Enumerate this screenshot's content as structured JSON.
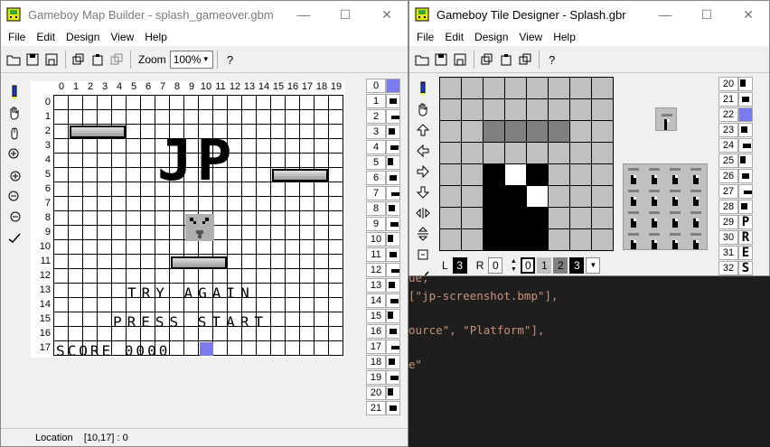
{
  "map_window": {
    "title": "Gameboy Map Builder - splash_gameover.gbm",
    "menu": [
      "File",
      "Edit",
      "Design",
      "View",
      "Help"
    ],
    "zoom_label": "Zoom",
    "zoom_value": "100%",
    "column_headers": [
      "0",
      "1",
      "2",
      "3",
      "4",
      "5",
      "6",
      "7",
      "8",
      "9",
      "10",
      "11",
      "12",
      "13",
      "14",
      "15",
      "16",
      "17",
      "18",
      "19"
    ],
    "row_headers": [
      "0",
      "1",
      "2",
      "3",
      "4",
      "5",
      "6",
      "7",
      "8",
      "9",
      "10",
      "11",
      "12",
      "13",
      "14",
      "15",
      "16",
      "17"
    ],
    "map_text": {
      "logo": "JP",
      "try_again": "TRY AGAIN",
      "press_start": "PRESS START",
      "score": "SCORE 0000"
    },
    "status": "Location    [10,17] : 0",
    "tile_numbers": [
      "0",
      "1",
      "2",
      "3",
      "4",
      "5",
      "6",
      "7",
      "8",
      "9",
      "10",
      "11",
      "12",
      "13",
      "14",
      "15",
      "16",
      "17",
      "18",
      "19",
      "20",
      "21"
    ]
  },
  "tile_window": {
    "title": "Gameboy Tile Designer - Splash.gbr",
    "menu": [
      "File",
      "Edit",
      "Design",
      "View",
      "Help"
    ],
    "palette_left_label": "L",
    "palette_left_value": "3",
    "palette_right_label": "R",
    "palette_right_value": "0",
    "palette_colors": [
      "0",
      "1",
      "2",
      "3"
    ],
    "tile_numbers": [
      "20",
      "21",
      "22",
      "23",
      "24",
      "25",
      "26",
      "27",
      "28",
      "29",
      "30",
      "31",
      "32"
    ],
    "tile_letters": {
      "29": "P",
      "30": "R",
      "31": "E",
      "32": "S"
    },
    "colors": {
      "c0": "#ffffff",
      "c1": "#c0c0c0",
      "c2": "#808080",
      "c3": "#000000"
    }
  },
  "editor": {
    "lines": [
      "ue,",
      "[\"jp-screenshot.bmp\"],",
      "ource\", \"Platform\"],",
      "e\""
    ]
  }
}
